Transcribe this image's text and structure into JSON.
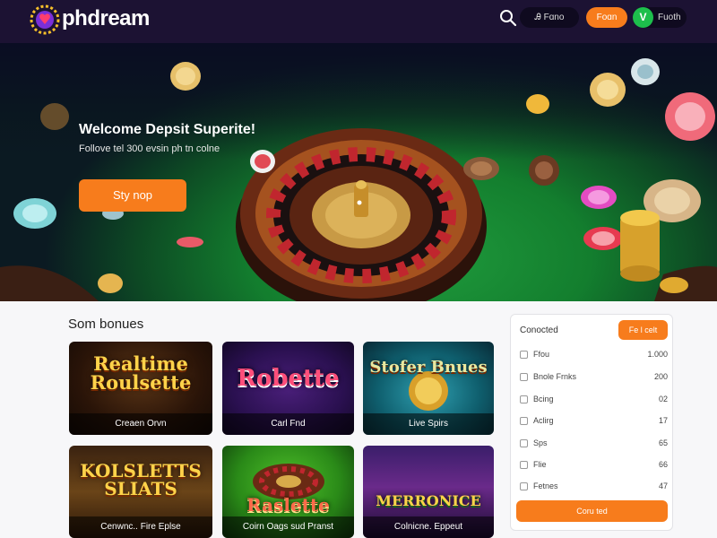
{
  "header": {
    "brand": "phdream",
    "login_label": "Ꭿ Fɑno",
    "register_label": "Foɑn",
    "user_initial": "V",
    "user_label": "Fuoth"
  },
  "hero": {
    "title": "Welcome Depsit Superite!",
    "subtitle": "Follove tel 300 evsin ph tn colne",
    "cta_label": "Sty nop"
  },
  "games": {
    "section_title": "Som bonues",
    "tiles": [
      {
        "title": "Realtime Roulsette",
        "caption": "Creaen Orvn"
      },
      {
        "title": "Robette",
        "caption": "Carl Fnd"
      },
      {
        "title": "Stofer Bnues",
        "caption": "Live Spirs"
      },
      {
        "title": "KOLSLETTS SLIATS",
        "caption": "Cenwnc.. Fire Eplse"
      },
      {
        "title": "Raslette",
        "caption": "Coirn Oags sud Pranst"
      },
      {
        "title": "MERRONICE",
        "caption": "Colnicne. Eppeut"
      }
    ]
  },
  "filters": {
    "title": "Conocted",
    "button_label": "Fe l celt",
    "rows": [
      {
        "label": "Ffou",
        "count": "1.000"
      },
      {
        "label": "Bnole Frnks",
        "count": "200"
      },
      {
        "label": "Bcing",
        "count": "02"
      },
      {
        "label": "Aclirg",
        "count": "17"
      },
      {
        "label": "Sps",
        "count": "65"
      },
      {
        "label": "Flie",
        "count": "66"
      },
      {
        "label": "Fetnes",
        "count": "47"
      }
    ],
    "cta_label": "Coru ted"
  },
  "colors": {
    "accent": "#f77c1c",
    "header_bg": "#1c1233",
    "felt": "#1f9a3c"
  }
}
